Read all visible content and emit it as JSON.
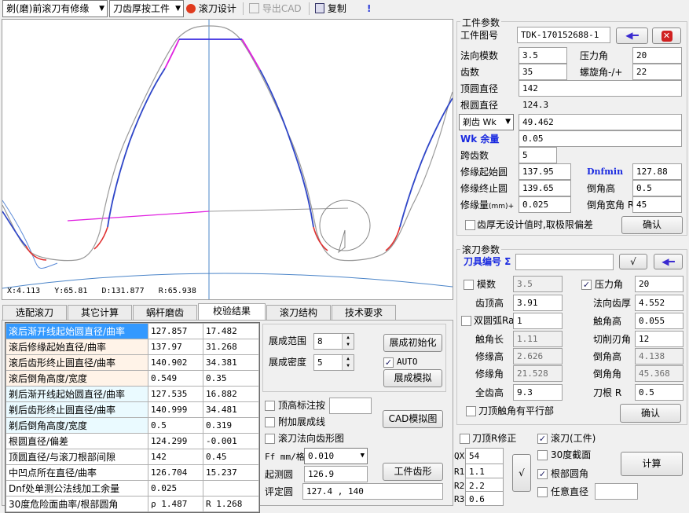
{
  "toolbar": {
    "mode_select": "剃(磨)前滚刀有修缘",
    "tooth_select": "刀齿厚按工件",
    "hob_design": "滚刀设计",
    "export_cad": "导出CAD",
    "copy": "复制",
    "info": "!"
  },
  "canvas": {
    "status": {
      "x": "X:4.113",
      "y": "Y:65.81",
      "d": "D:131.877",
      "r": "R:65.938"
    }
  },
  "tabs": [
    "选配滚刀",
    "其它计算",
    "蜗杆磨齿",
    "校验结果",
    "滚刀结构",
    "技术要求"
  ],
  "active_tab": "校验结果",
  "results": [
    {
      "label": "滚后渐开线起始圆直径/曲率",
      "v1": "127.857",
      "v2": "17.482",
      "kind": "pk",
      "selected": true
    },
    {
      "label": "滚后修缘起始直径/曲率",
      "v1": "137.97",
      "v2": "31.268",
      "kind": "pk"
    },
    {
      "label": "滚后齿形终止圆直径/曲率",
      "v1": "140.902",
      "v2": "34.381",
      "kind": "pk"
    },
    {
      "label": "滚后倒角高度/宽度",
      "v1": "0.549",
      "v2": "0.35",
      "kind": "pk"
    },
    {
      "label": "剃后渐开线起始圆直径/曲率",
      "v1": "127.535",
      "v2": "16.882",
      "kind": "bl"
    },
    {
      "label": "剃后齿形终止圆直径/曲率",
      "v1": "140.999",
      "v2": "34.481",
      "kind": "bl"
    },
    {
      "label": "剃后倒角高度/宽度",
      "v1": "0.5",
      "v2": "0.319",
      "kind": "bl"
    },
    {
      "label": "根圆直径/偏差",
      "v1": "124.299",
      "v2": "-0.001",
      "kind": "wh"
    },
    {
      "label": "顶圆直径/与滚刀根部间隙",
      "v1": "142",
      "v2": "0.45",
      "kind": "wh"
    },
    {
      "label": "中凹点所在直径/曲率",
      "v1": "126.704",
      "v2": "15.237",
      "kind": "wh"
    },
    {
      "label": "Dnf处单测公法线加工余量",
      "v1": "0.025",
      "v2": "",
      "kind": "wh"
    },
    {
      "label": "30度危险面曲率/根部圆角",
      "v1": "ρ 1.487",
      "v2": "R 1.268",
      "kind": "wh"
    }
  ],
  "gen": {
    "range_label": "展成范围",
    "range_value": "8",
    "density_label": "展成密度",
    "density_value": "5",
    "init_button": "展成初始化",
    "auto_label": "AUTO",
    "auto_checked": true,
    "simulate_button": "展成模拟",
    "tip_mark_label": "顶高标注按",
    "extra_root_label": "附加展成线",
    "normal_profile_label": "滚刀法向齿形图",
    "cad_sim_button": "CAD模拟图",
    "ff_label": "Ff mm/格",
    "ff_value": "0.010",
    "start_circle_label": "起测圆",
    "start_circle_value": "126.9",
    "eval_circle_label": "评定圆",
    "eval_circle_value": "127.4 , 140",
    "profile_button": "工件齿形"
  },
  "workpiece": {
    "title": "工件参数",
    "drawing_no_label": "工件图号",
    "drawing_no": "TDK-170152688-1",
    "module_label": "法向模数",
    "module": "3.5",
    "pressure_label": "压力角",
    "pressure": "20",
    "teeth_label": "齿数",
    "teeth": "35",
    "helix_label": "螺旋角-/+",
    "helix": "22",
    "tip_dia_label": "顶圆直径",
    "tip_dia": "142",
    "root_dia_label": "根圆直径",
    "root_dia": "124.3",
    "wk_select": "剃齿 Wk",
    "wk_value": "49.462",
    "wk_allow_label": "Wk 余量",
    "wk_allow": "0.05",
    "span_label": "跨齿数",
    "span": "5",
    "mod_start_label": "修缘起始圆",
    "mod_start": "137.95",
    "dnfmin_label": "Dnfmin",
    "dnfmin": "127.88",
    "mod_end_label": "修缘终止圆",
    "mod_end": "139.65",
    "chamfer_h_label": "倒角高",
    "chamfer_h": "0.5",
    "mod_amount_label": "修缘量",
    "mod_amount_unit": "(mm)+",
    "mod_amount": "0.025",
    "chamfer_w_label": "倒角宽角 R",
    "chamfer_w": "45",
    "limit_label": "齿厚无设计值时,取极限偏差",
    "confirm": "确认"
  },
  "hob": {
    "title": "滚刀参数",
    "tool_no_label": "刀具编号 Σ",
    "tool_no": "",
    "module_label": "模数",
    "module": "3.5",
    "pressure_label": "压力角",
    "pressure": "20",
    "pressure_checked": true,
    "tip_height_label": "齿顶高",
    "tip_height": "3.91",
    "normal_thick_label": "法向齿厚",
    "normal_thick": "4.552",
    "double_arc_label": "双圆弧Ra",
    "double_arc": "1",
    "touch_h_label": "触角高",
    "touch_h": "0.055",
    "touch_len_label": "触角长",
    "touch_len": "1.11",
    "cut_angle_label": "切削刃角",
    "cut_angle": "12",
    "mod_h_label": "修缘高",
    "mod_h": "2.626",
    "chamfer_h_label": "倒角高",
    "chamfer_h": "4.138",
    "mod_angle_label": "修缘角",
    "mod_angle": "21.528",
    "chamfer_angle_label": "倒角角",
    "chamfer_angle": "45.368",
    "full_h_label": "全齿高",
    "full_h": "9.3",
    "root_r_label": "刀根 R",
    "root_r": "0.5",
    "parallel_label": "刀顶触角有平行部",
    "confirm": "确认"
  },
  "bottom": {
    "tip_r_label": "刀顶R修正",
    "hob_work_label": "滚刀(工件)",
    "hob_work_checked": true,
    "section30_label": "30度截面",
    "root_fillet_label": "根部圆角",
    "root_fillet_checked": true,
    "any_dia_label": "任意直径",
    "qx_label": "QX",
    "qx": "54",
    "r1_label": "R1",
    "r1": "1.1",
    "r2_label": "R2",
    "r2": "2.2",
    "r3_label": "R3",
    "r3": "0.6",
    "calc_button": "计算"
  },
  "colors": {
    "selection": "#3399ff",
    "profile_blue": "#2f46c8",
    "profile_magenta": "#e020e0",
    "root_red": "#e03030",
    "axis": "#4a84c8"
  }
}
